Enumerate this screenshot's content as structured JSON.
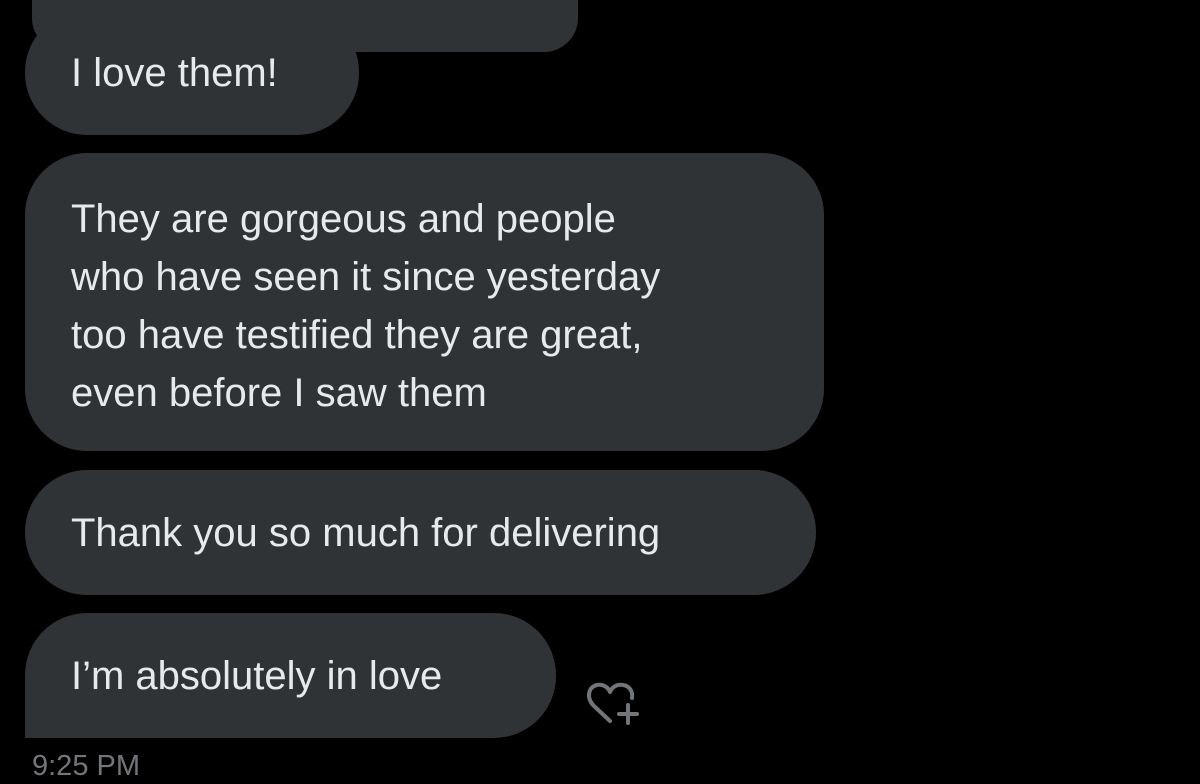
{
  "conversation": {
    "messages": [
      {
        "text": "I love them!"
      },
      {
        "lines": [
          "They are gorgeous and people",
          "who have seen it since yesterday",
          "too have testified they are great,",
          "even before I saw them"
        ]
      },
      {
        "text": "Thank you so much for delivering"
      },
      {
        "text": "I’m absolutely in love"
      }
    ],
    "timestamp": "9:25 PM",
    "react_icon": "heart-plus-icon"
  },
  "colors": {
    "background": "#000000",
    "bubble": "#2f3336",
    "text": "#e7e9ea",
    "timestamp": "#71767b"
  }
}
